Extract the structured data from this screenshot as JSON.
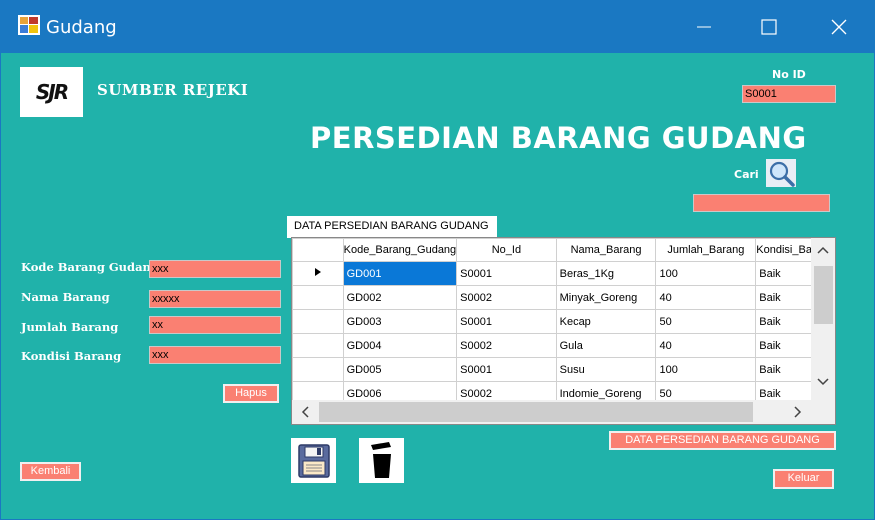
{
  "window": {
    "title": "Gudang"
  },
  "header": {
    "logo_text": "SJR",
    "brand": "SUMBER REJEKI",
    "main_title": "PERSEDIAN BARANG GUDANG",
    "no_id_label": "No ID",
    "no_id_value": "S0001",
    "cari_label": "Cari",
    "search_value": ""
  },
  "form": {
    "kode_label": "Kode Barang Gudang",
    "kode_value": "xxx",
    "nama_label": "Nama Barang",
    "nama_value": "xxxxx",
    "jumlah_label": "Jumlah Barang",
    "jumlah_value": "xx",
    "kondisi_label": "Kondisi Barang",
    "kondisi_value": "xxx"
  },
  "buttons": {
    "hapus": "Hapus",
    "kembali": "Kembali",
    "keluar": "Keluar",
    "data_persedian": "DATA PERSEDIAN BARANG GUDANG"
  },
  "grid": {
    "group_title": "DATA PERSEDIAN BARANG GUDANG",
    "columns": [
      "Kode_Barang_Gudang",
      "No_Id",
      "Nama_Barang",
      "Jumlah_Barang",
      "Kondisi_Barang"
    ],
    "rows": [
      [
        "GD001",
        "S0001",
        "Beras_1Kg",
        "100",
        "Baik"
      ],
      [
        "GD002",
        "S0002",
        "Minyak_Goreng",
        "40",
        "Baik"
      ],
      [
        "GD003",
        "S0001",
        "Kecap",
        "50",
        "Baik"
      ],
      [
        "GD004",
        "S0002",
        "Gula",
        "40",
        "Baik"
      ],
      [
        "GD005",
        "S0001",
        "Susu",
        "100",
        "Baik"
      ],
      [
        "GD006",
        "S0002",
        "Indomie_Goreng",
        "50",
        "Baik"
      ]
    ]
  },
  "colors": {
    "accent": "#20b2aa",
    "field": "#fa8072",
    "titlebar": "#1a78c2",
    "selection": "#0a78d7"
  }
}
